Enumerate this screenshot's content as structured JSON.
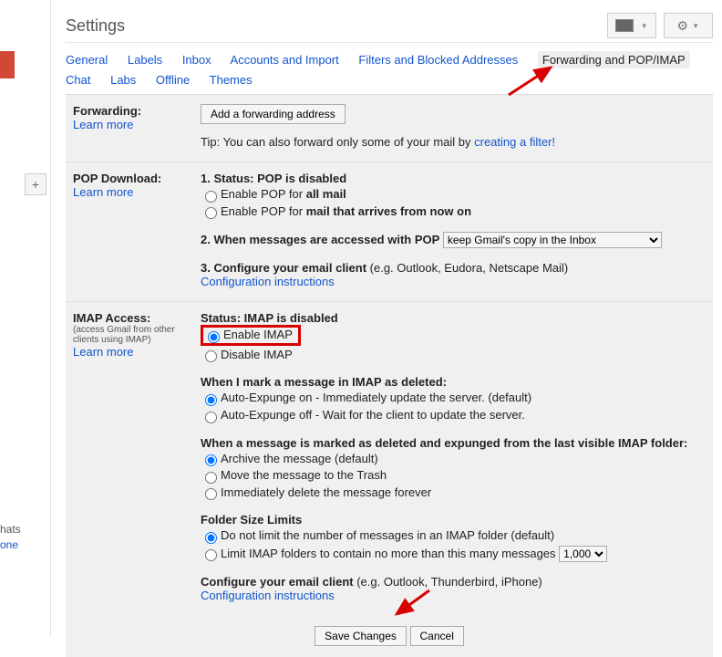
{
  "header": {
    "title": "Settings"
  },
  "left": {
    "hats": "hats",
    "one": "one",
    "plus": "+"
  },
  "tabs": {
    "general": "General",
    "labels": "Labels",
    "inbox": "Inbox",
    "accounts": "Accounts and Import",
    "filters": "Filters and Blocked Addresses",
    "forwarding": "Forwarding and POP/IMAP",
    "chat": "Chat",
    "labs": "Labs",
    "offline": "Offline",
    "themes": "Themes"
  },
  "forwarding": {
    "title": "Forwarding:",
    "learn": "Learn more",
    "add_btn": "Add a forwarding address",
    "tip_pre": "Tip: You can also forward only some of your mail by ",
    "tip_link": "creating a filter!"
  },
  "pop": {
    "title": "POP Download:",
    "learn": "Learn more",
    "status_lbl": "1. Status: ",
    "status_val": "POP is disabled",
    "enable_all_pre": "Enable POP for ",
    "enable_all_bold": "all mail",
    "enable_now_pre": "Enable POP for ",
    "enable_now_bold": "mail that arrives from now on",
    "access_lbl": "2. When messages are accessed with POP",
    "access_select": "keep Gmail's copy in the Inbox",
    "config_lbl": "3. Configure your email client ",
    "config_paren": "(e.g. Outlook, Eudora, Netscape Mail)",
    "config_link": "Configuration instructions"
  },
  "imap": {
    "title": "IMAP Access:",
    "sub": "(access Gmail from other clients using IMAP)",
    "learn": "Learn more",
    "status_lbl": "Status: ",
    "status_val": "IMAP is disabled",
    "enable": "Enable IMAP",
    "disable": "Disable IMAP",
    "mark_hdr": "When I mark a message in IMAP as deleted:",
    "exp_on": "Auto-Expunge on - Immediately update the server. (default)",
    "exp_off": "Auto-Expunge off - Wait for the client to update the server.",
    "expunged_hdr": "When a message is marked as deleted and expunged from the last visible IMAP folder:",
    "archive": "Archive the message (default)",
    "trash": "Move the message to the Trash",
    "delete": "Immediately delete the message forever",
    "folder_hdr": "Folder Size Limits",
    "nolimit": "Do not limit the number of messages in an IMAP folder (default)",
    "limit": "Limit IMAP folders to contain no more than this many messages",
    "limit_select": "1,000",
    "config_lbl": "Configure your email client ",
    "config_paren": "(e.g. Outlook, Thunderbird, iPhone)",
    "config_link": "Configuration instructions"
  },
  "footer": {
    "save": "Save Changes",
    "cancel": "Cancel"
  }
}
